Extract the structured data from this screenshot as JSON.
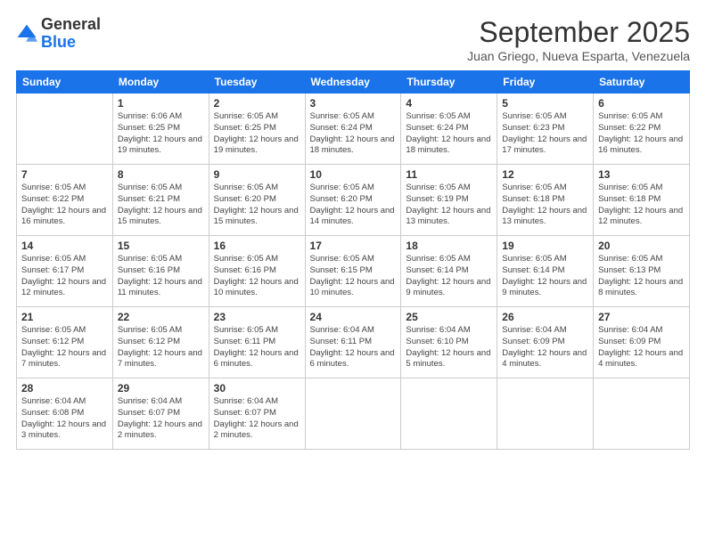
{
  "header": {
    "logo_general": "General",
    "logo_blue": "Blue",
    "month_title": "September 2025",
    "subtitle": "Juan Griego, Nueva Esparta, Venezuela"
  },
  "calendar": {
    "days_of_week": [
      "Sunday",
      "Monday",
      "Tuesday",
      "Wednesday",
      "Thursday",
      "Friday",
      "Saturday"
    ],
    "weeks": [
      [
        {
          "day": "",
          "info": ""
        },
        {
          "day": "1",
          "info": "Sunrise: 6:06 AM\nSunset: 6:25 PM\nDaylight: 12 hours\nand 19 minutes."
        },
        {
          "day": "2",
          "info": "Sunrise: 6:05 AM\nSunset: 6:25 PM\nDaylight: 12 hours\nand 19 minutes."
        },
        {
          "day": "3",
          "info": "Sunrise: 6:05 AM\nSunset: 6:24 PM\nDaylight: 12 hours\nand 18 minutes."
        },
        {
          "day": "4",
          "info": "Sunrise: 6:05 AM\nSunset: 6:24 PM\nDaylight: 12 hours\nand 18 minutes."
        },
        {
          "day": "5",
          "info": "Sunrise: 6:05 AM\nSunset: 6:23 PM\nDaylight: 12 hours\nand 17 minutes."
        },
        {
          "day": "6",
          "info": "Sunrise: 6:05 AM\nSunset: 6:22 PM\nDaylight: 12 hours\nand 16 minutes."
        }
      ],
      [
        {
          "day": "7",
          "info": "Sunrise: 6:05 AM\nSunset: 6:22 PM\nDaylight: 12 hours\nand 16 minutes."
        },
        {
          "day": "8",
          "info": "Sunrise: 6:05 AM\nSunset: 6:21 PM\nDaylight: 12 hours\nand 15 minutes."
        },
        {
          "day": "9",
          "info": "Sunrise: 6:05 AM\nSunset: 6:20 PM\nDaylight: 12 hours\nand 15 minutes."
        },
        {
          "day": "10",
          "info": "Sunrise: 6:05 AM\nSunset: 6:20 PM\nDaylight: 12 hours\nand 14 minutes."
        },
        {
          "day": "11",
          "info": "Sunrise: 6:05 AM\nSunset: 6:19 PM\nDaylight: 12 hours\nand 13 minutes."
        },
        {
          "day": "12",
          "info": "Sunrise: 6:05 AM\nSunset: 6:18 PM\nDaylight: 12 hours\nand 13 minutes."
        },
        {
          "day": "13",
          "info": "Sunrise: 6:05 AM\nSunset: 6:18 PM\nDaylight: 12 hours\nand 12 minutes."
        }
      ],
      [
        {
          "day": "14",
          "info": "Sunrise: 6:05 AM\nSunset: 6:17 PM\nDaylight: 12 hours\nand 12 minutes."
        },
        {
          "day": "15",
          "info": "Sunrise: 6:05 AM\nSunset: 6:16 PM\nDaylight: 12 hours\nand 11 minutes."
        },
        {
          "day": "16",
          "info": "Sunrise: 6:05 AM\nSunset: 6:16 PM\nDaylight: 12 hours\nand 10 minutes."
        },
        {
          "day": "17",
          "info": "Sunrise: 6:05 AM\nSunset: 6:15 PM\nDaylight: 12 hours\nand 10 minutes."
        },
        {
          "day": "18",
          "info": "Sunrise: 6:05 AM\nSunset: 6:14 PM\nDaylight: 12 hours\nand 9 minutes."
        },
        {
          "day": "19",
          "info": "Sunrise: 6:05 AM\nSunset: 6:14 PM\nDaylight: 12 hours\nand 9 minutes."
        },
        {
          "day": "20",
          "info": "Sunrise: 6:05 AM\nSunset: 6:13 PM\nDaylight: 12 hours\nand 8 minutes."
        }
      ],
      [
        {
          "day": "21",
          "info": "Sunrise: 6:05 AM\nSunset: 6:12 PM\nDaylight: 12 hours\nand 7 minutes."
        },
        {
          "day": "22",
          "info": "Sunrise: 6:05 AM\nSunset: 6:12 PM\nDaylight: 12 hours\nand 7 minutes."
        },
        {
          "day": "23",
          "info": "Sunrise: 6:05 AM\nSunset: 6:11 PM\nDaylight: 12 hours\nand 6 minutes."
        },
        {
          "day": "24",
          "info": "Sunrise: 6:04 AM\nSunset: 6:11 PM\nDaylight: 12 hours\nand 6 minutes."
        },
        {
          "day": "25",
          "info": "Sunrise: 6:04 AM\nSunset: 6:10 PM\nDaylight: 12 hours\nand 5 minutes."
        },
        {
          "day": "26",
          "info": "Sunrise: 6:04 AM\nSunset: 6:09 PM\nDaylight: 12 hours\nand 4 minutes."
        },
        {
          "day": "27",
          "info": "Sunrise: 6:04 AM\nSunset: 6:09 PM\nDaylight: 12 hours\nand 4 minutes."
        }
      ],
      [
        {
          "day": "28",
          "info": "Sunrise: 6:04 AM\nSunset: 6:08 PM\nDaylight: 12 hours\nand 3 minutes."
        },
        {
          "day": "29",
          "info": "Sunrise: 6:04 AM\nSunset: 6:07 PM\nDaylight: 12 hours\nand 2 minutes."
        },
        {
          "day": "30",
          "info": "Sunrise: 6:04 AM\nSunset: 6:07 PM\nDaylight: 12 hours\nand 2 minutes."
        },
        {
          "day": "",
          "info": ""
        },
        {
          "day": "",
          "info": ""
        },
        {
          "day": "",
          "info": ""
        },
        {
          "day": "",
          "info": ""
        }
      ]
    ]
  }
}
